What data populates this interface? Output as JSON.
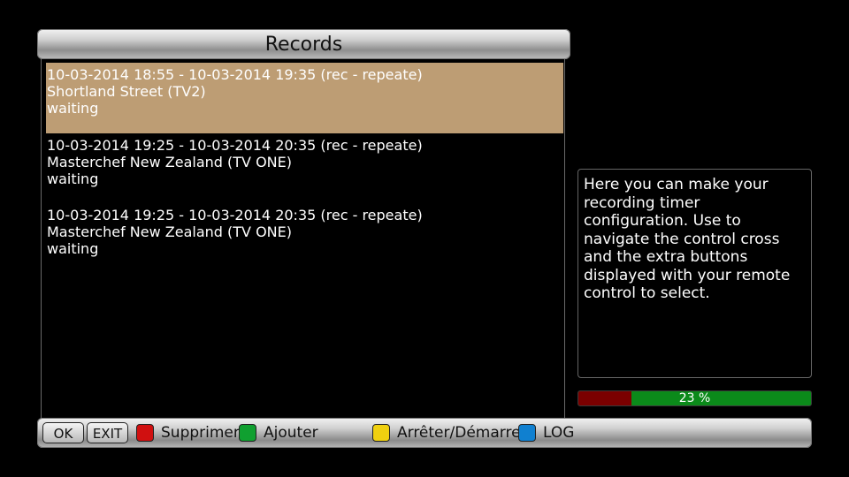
{
  "header": {
    "title": "Records"
  },
  "records": [
    {
      "time": "10-03-2014 18:55 - 10-03-2014 19:35 (rec - repeate)",
      "channel": "Shortland Street (TV2)",
      "status": "waiting",
      "selected": true
    },
    {
      "time": "10-03-2014 19:25 - 10-03-2014 20:35 (rec - repeate)",
      "channel": "Masterchef New Zealand (TV ONE)",
      "status": "waiting",
      "selected": false
    },
    {
      "time": "10-03-2014 19:25 - 10-03-2014 20:35 (rec - repeate)",
      "channel": "Masterchef New Zealand (TV ONE)",
      "status": "waiting",
      "selected": false
    }
  ],
  "help": {
    "text": "Here you can make your recording timer configuration. Use to navigate the control cross and the extra buttons displayed with your remote control to select."
  },
  "progress": {
    "percent": 23,
    "label": "23 %"
  },
  "footer": {
    "ok_label": "OK",
    "exit_label": "EXIT",
    "red_label": "Supprimer",
    "green_label": "Ajouter",
    "yellow_label": "Arrêter/Démarre",
    "blue_label": "LOG"
  },
  "colors": {
    "selected_row": "#bd9d74",
    "red": "#d01010",
    "green": "#10a030",
    "yellow": "#f0d010",
    "blue": "#1080d0",
    "progress_fill": "#7a0000",
    "progress_bg": "#0b8a1a"
  }
}
